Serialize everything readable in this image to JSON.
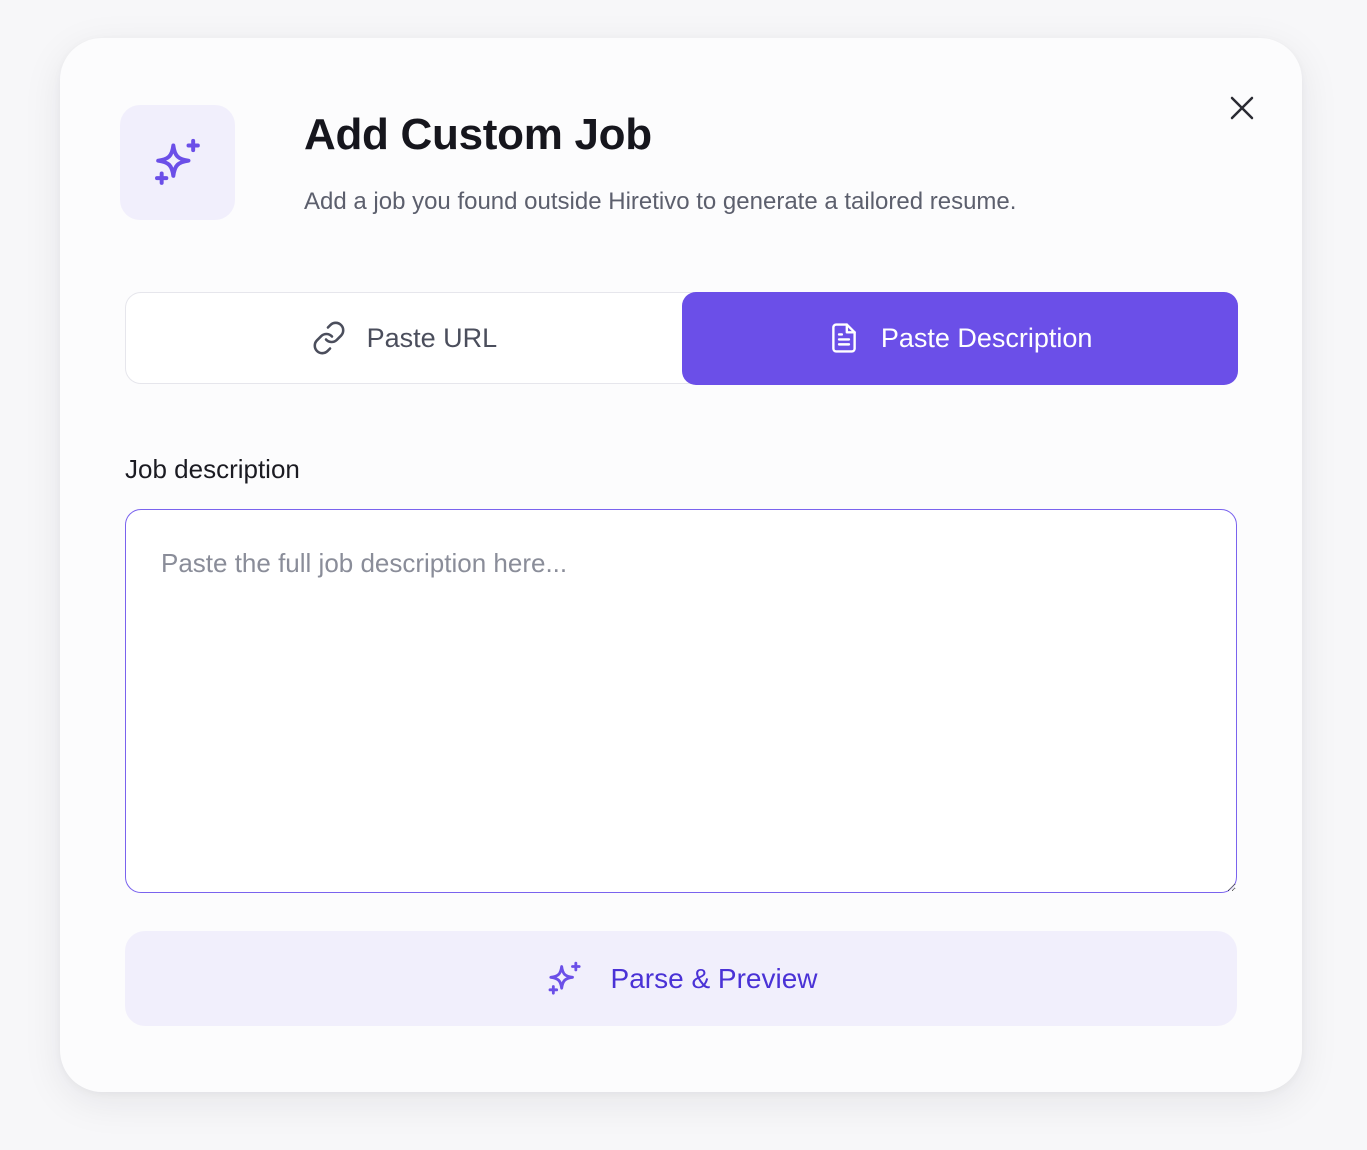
{
  "modal": {
    "title": "Add Custom Job",
    "subtitle": "Add a job you found outside Hiretivo to generate a tailored resume.",
    "header_icon": "sparkles-icon",
    "close_icon": "close-icon"
  },
  "tabs": [
    {
      "label": "Paste URL",
      "icon": "link-icon",
      "active": false
    },
    {
      "label": "Paste Description",
      "icon": "document-icon",
      "active": true
    }
  ],
  "job_description": {
    "label": "Job description",
    "value": "",
    "placeholder": "Paste the full job description here..."
  },
  "parse_button": {
    "label": "Parse & Preview",
    "icon": "sparkles-icon"
  },
  "colors": {
    "accent": "#6b4fe8",
    "accent_soft": "#f1effc",
    "accent_text": "#4a32d6"
  }
}
